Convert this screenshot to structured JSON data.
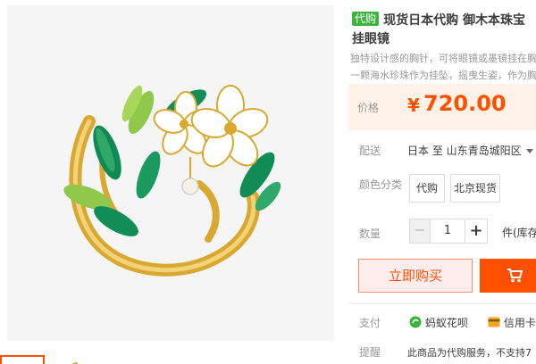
{
  "product": {
    "badge": "代购",
    "title_line1": "现货日本代购 御木本珠宝",
    "title_line2": "挂眼镜",
    "subtitle_line1": "独特设计感的胸针，可将眼镜或墨镜挂在胸",
    "subtitle_line2": "一颗海水珍珠作为挂坠，摇曳生姿，作为胸"
  },
  "price": {
    "label": "价格",
    "symbol": "¥",
    "value": "720.00"
  },
  "shipping": {
    "label": "配送",
    "text": "日本 至  山东青岛城阳区"
  },
  "color": {
    "label": "颜色分类",
    "options": [
      "代购",
      "北京现货"
    ]
  },
  "quantity": {
    "label": "数量",
    "minus": "−",
    "value": "1",
    "plus": "+",
    "unit": "件(库存"
  },
  "actions": {
    "buy_now": "立即购买"
  },
  "payment": {
    "label": "支付",
    "methods": [
      "蚂蚁花呗",
      "信用卡"
    ]
  },
  "remind": {
    "label": "提醒",
    "text": "此商品为代购服务，不支持7"
  },
  "colors": {
    "accent": "#ff5000",
    "badge": "#3db33d",
    "price_bg": "#fff2e8"
  }
}
